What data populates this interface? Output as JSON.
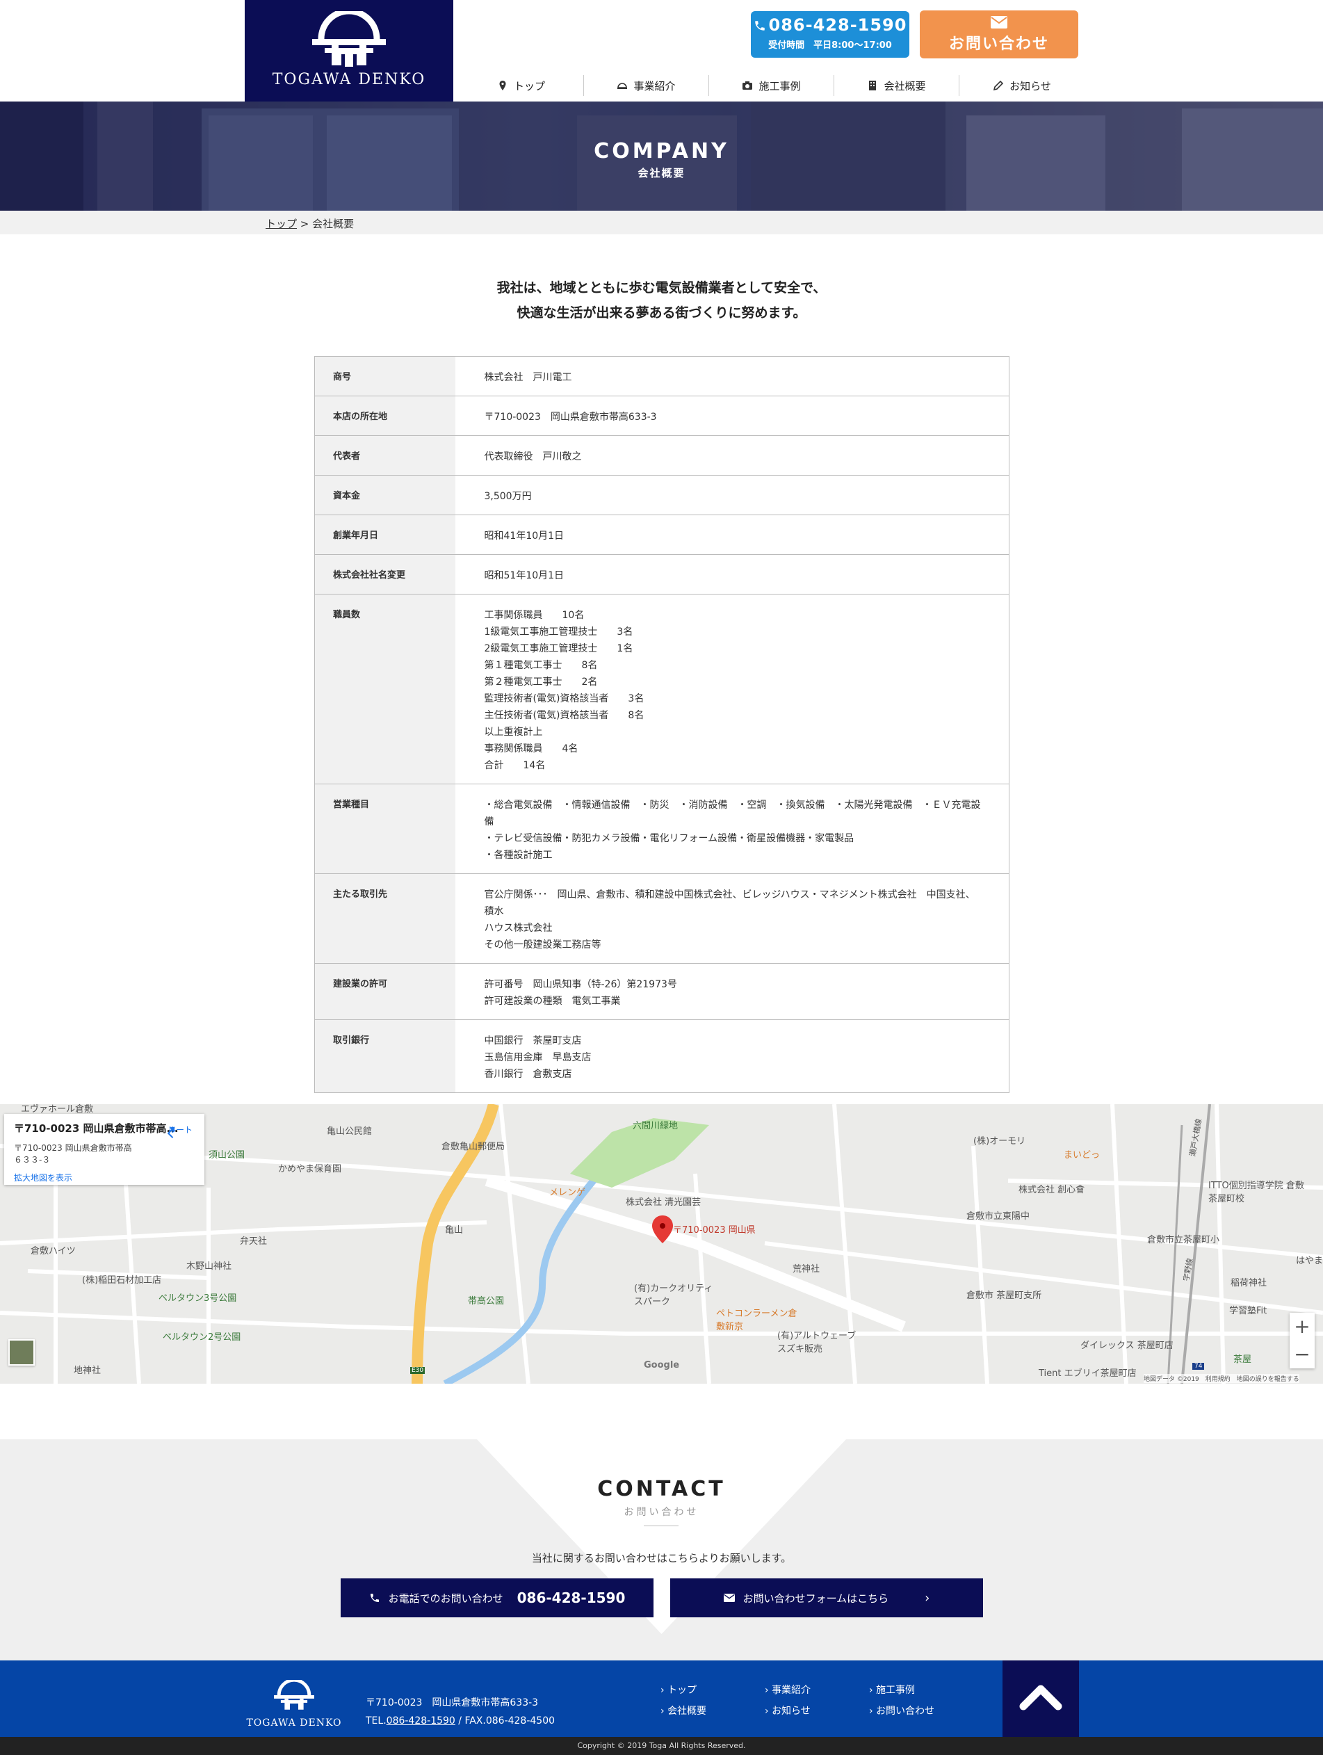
{
  "header": {
    "logo_text": "TOGAWA DENKO",
    "tel_number": "086-428-1590",
    "tel_hours": "受付時間　平日8:00〜17:00",
    "contact_label": "お問い合わせ",
    "nav": [
      {
        "label": "トップ",
        "icon": "map-pin-icon"
      },
      {
        "label": "事業紹介",
        "icon": "helmet-icon"
      },
      {
        "label": "施工事例",
        "icon": "camera-icon"
      },
      {
        "label": "会社概要",
        "icon": "building-icon"
      },
      {
        "label": "お知らせ",
        "icon": "pencil-icon"
      }
    ]
  },
  "hero": {
    "title": "COMPANY",
    "subtitle": "会社概要"
  },
  "breadcrumb": {
    "home": "トップ",
    "separator": ">",
    "current": "会社概要"
  },
  "intro": {
    "line1": "我社は、地域とともに歩む電気設備業者として安全で、",
    "line2": "快適な生活が出来る夢ある街づくりに努めます。"
  },
  "company_table": [
    {
      "label": "商号",
      "lines": [
        "株式会社　戸川電工"
      ]
    },
    {
      "label": "本店の所在地",
      "lines": [
        "〒710-0023　岡山県倉敷市帯高633-3"
      ]
    },
    {
      "label": "代表者",
      "lines": [
        "代表取締役　戸川敬之"
      ]
    },
    {
      "label": "資本金",
      "lines": [
        "3,500万円"
      ]
    },
    {
      "label": "創業年月日",
      "lines": [
        "昭和41年10月1日"
      ]
    },
    {
      "label": "株式会社社名変更",
      "lines": [
        "昭和51年10月1日"
      ]
    },
    {
      "label": "職員数",
      "lines": [
        "工事関係職員　　10名",
        "1級電気工事施工管理技士　　3名",
        "2級電気工事施工管理技士　　1名",
        "第１種電気工事士　　8名",
        "第２種電気工事士　　2名",
        "監理技術者(電気)資格該当者　　3名",
        "主任技術者(電気)資格該当者　　8名",
        "以上重複計上",
        "事務関係職員　　4名",
        "合計　　14名"
      ]
    },
    {
      "label": "営業種目",
      "lines": [
        "・総合電気設備　・情報通信設備　・防災　・消防設備　・空調　・換気設備　・太陽光発電設備　・ＥＶ充電設備",
        "・テレビ受信設備・防犯カメラ設備・電化リフォーム設備・衛星設備機器・家電製品",
        "・各種設計施工"
      ]
    },
    {
      "label": "主たる取引先",
      "lines": [
        "官公庁関係･･･　岡山県、倉敷市、積和建設中国株式会社、ビレッジハウス・マネジメント株式会社　中国支社、積水",
        "ハウス株式会社",
        "その他一般建設業工務店等"
      ]
    },
    {
      "label": "建設業の許可",
      "lines": [
        "許可番号　岡山県知事（特-26）第21973号",
        "許可建設業の種類　電気工事業"
      ]
    },
    {
      "label": "取引銀行",
      "lines": [
        "中国銀行　茶屋町支店",
        "玉島信用金庫　早島支店",
        "香川銀行　倉敷支店"
      ]
    }
  ],
  "map": {
    "card_title": "〒710-0023 岡山県倉敷市帯高...",
    "card_addr": "〒710-0023 岡山県倉敷市帯高６３３-３",
    "card_route": "ルート",
    "card_link": "拡大地図を表示",
    "marker_label": "〒710-0023 岡山県",
    "labels": [
      {
        "text": "エヴァホール倉敷",
        "cls": ""
      },
      {
        "text": "亀山公民館",
        "cls": ""
      },
      {
        "text": "倉敷亀山郵便局",
        "cls": ""
      },
      {
        "text": "六間川緑地",
        "cls": "green"
      },
      {
        "text": "(株)オーモリ",
        "cls": ""
      },
      {
        "text": "まいどっ",
        "cls": "orange"
      },
      {
        "text": "かめやま保育園",
        "cls": ""
      },
      {
        "text": "須山公園",
        "cls": "green"
      },
      {
        "text": "株式会社 創心會",
        "cls": ""
      },
      {
        "text": "ITTO個別指導学院 倉敷茶屋町校",
        "cls": ""
      },
      {
        "text": "メレンゲ",
        "cls": "orange"
      },
      {
        "text": "株式会社 清光園芸",
        "cls": ""
      },
      {
        "text": "倉敷市立東陽中",
        "cls": ""
      },
      {
        "text": "倉敷ハイツ",
        "cls": ""
      },
      {
        "text": "弁天社",
        "cls": ""
      },
      {
        "text": "亀山",
        "cls": ""
      },
      {
        "text": "倉敷市立茶屋町小",
        "cls": ""
      },
      {
        "text": "木野山神社",
        "cls": ""
      },
      {
        "text": "荒神社",
        "cls": ""
      },
      {
        "text": "はやま",
        "cls": ""
      },
      {
        "text": "(株)稲田石材加工店",
        "cls": ""
      },
      {
        "text": "(有)カークオリティスパーク",
        "cls": ""
      },
      {
        "text": "稲荷神社",
        "cls": ""
      },
      {
        "text": "ベルタウン3号公園",
        "cls": "green"
      },
      {
        "text": "帯高公園",
        "cls": "green"
      },
      {
        "text": "倉敷市 茶屋町支所",
        "cls": ""
      },
      {
        "text": "学習塾Fit",
        "cls": ""
      },
      {
        "text": "ペトコンラーメン倉敷新京",
        "cls": "orange"
      },
      {
        "text": "ベルタウン2号公園",
        "cls": "green"
      },
      {
        "text": "(有)アルトウェーブ スズキ販売",
        "cls": ""
      },
      {
        "text": "ダイレックス 茶屋町店",
        "cls": ""
      },
      {
        "text": "茶屋",
        "cls": "green"
      },
      {
        "text": "地神社",
        "cls": ""
      },
      {
        "text": "Google",
        "cls": ""
      },
      {
        "text": "Tient エブリイ茶屋町店",
        "cls": ""
      },
      {
        "text": "E30",
        "cls": ""
      },
      {
        "text": "74",
        "cls": ""
      },
      {
        "text": "宇野線",
        "cls": ""
      },
      {
        "text": "瀬戸大橋線",
        "cls": ""
      }
    ],
    "zoom_in": "+",
    "zoom_out": "−",
    "attribution": "地図データ ©2019　利用規約　地図の誤りを報告する"
  },
  "contact": {
    "title": "CONTACT",
    "subtitle": "お問い合わせ",
    "desc": "当社に関するお問い合わせはこちらよりお願いします。",
    "tel_label": "お電話でのお問い合わせ",
    "tel_number": "086-428-1590",
    "form_label": "お問い合わせフォームはこちら",
    "form_arrow": "›"
  },
  "footer": {
    "logo_text": "TOGAWA DENKO",
    "address": "〒710-0023　岡山県倉敷市帯高633-3",
    "tel_prefix": "TEL.",
    "tel": "086-428-1590",
    "fax": " / FAX.086-428-4500",
    "nav": [
      "トップ",
      "事業紹介",
      "施工事例",
      "会社概要",
      "お知らせ",
      "お問い合わせ"
    ],
    "copyright": "Copyright © 2019 Toga All Rights Reserved."
  },
  "colors": {
    "navy": "#0b0d55",
    "blue": "#1d8fd8",
    "orange": "#f2934d",
    "footer_blue": "#0545a6"
  }
}
